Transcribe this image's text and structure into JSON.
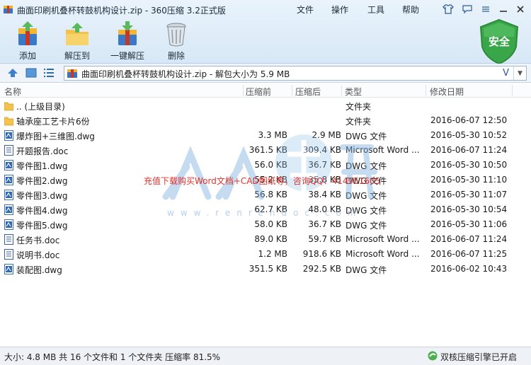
{
  "window": {
    "title": "曲面印刷机叠杯转鼓机构设计.zip - 360压缩 3.2正式版",
    "menu": [
      "文件",
      "操作",
      "工具",
      "帮助"
    ]
  },
  "toolbar": {
    "add_label": "添加",
    "extract_label": "解压到",
    "one_click_label": "一键解压",
    "delete_label": "删除"
  },
  "security_badge": {
    "label": "安全",
    "color": "#3aa64a"
  },
  "address": {
    "path_text": "曲面印刷机叠杯转鼓机构设计.zip - 解包大小为 5.9 MB",
    "v_mark": "V"
  },
  "columns": {
    "name": "名称",
    "size": "压缩前",
    "packed": "压缩后",
    "type": "类型",
    "modified": "修改日期"
  },
  "files": [
    {
      "name": ".. (上级目录)",
      "size": "",
      "packed": "",
      "type": "文件夹",
      "modified": "",
      "icon": "folder-icon"
    },
    {
      "name": "轴承座工艺卡片6份",
      "size": "",
      "packed": "",
      "type": "文件夹",
      "modified": "2016-06-07 12:50",
      "icon": "folder-icon"
    },
    {
      "name": "爆炸图+三维图.dwg",
      "size": "3.3 MB",
      "packed": "2.9 MB",
      "type": "DWG 文件",
      "modified": "2016-05-30 10:52",
      "icon": "dwg-file-icon"
    },
    {
      "name": "开题报告.doc",
      "size": "361.5 KB",
      "packed": "309.4 KB",
      "type": "Microsoft Word ...",
      "modified": "2016-06-07 11:24",
      "icon": "doc-file-icon"
    },
    {
      "name": "零件图1.dwg",
      "size": "56.0 KB",
      "packed": "36.7 KB",
      "type": "DWG 文件",
      "modified": "2016-05-30 10:50",
      "icon": "dwg-file-icon"
    },
    {
      "name": "零件图2.dwg",
      "size": "55.2 KB",
      "packed": "35.8 KB",
      "type": "DWG 文件",
      "modified": "2016-05-30 11:10",
      "icon": "dwg-file-icon"
    },
    {
      "name": "零件图3.dwg",
      "size": "56.8 KB",
      "packed": "38.4 KB",
      "type": "DWG 文件",
      "modified": "2016-05-30 11:07",
      "icon": "dwg-file-icon"
    },
    {
      "name": "零件图4.dwg",
      "size": "62.7 KB",
      "packed": "48.0 KB",
      "type": "DWG 文件",
      "modified": "2016-05-30 10:54",
      "icon": "dwg-file-icon"
    },
    {
      "name": "零件图5.dwg",
      "size": "58.0 KB",
      "packed": "36.7 KB",
      "type": "DWG 文件",
      "modified": "2016-05-30 11:06",
      "icon": "dwg-file-icon"
    },
    {
      "name": "任务书.doc",
      "size": "89.0 KB",
      "packed": "59.7 KB",
      "type": "Microsoft Word ...",
      "modified": "2016-06-07 11:24",
      "icon": "doc-file-icon"
    },
    {
      "name": "说明书.doc",
      "size": "1.2 MB",
      "packed": "918.6 KB",
      "type": "Microsoft Word ...",
      "modified": "2016-06-07 11:25",
      "icon": "doc-file-icon"
    },
    {
      "name": "装配图.dwg",
      "size": "351.5 KB",
      "packed": "292.5 KB",
      "type": "DWG 文件",
      "modified": "2016-06-02 10:43",
      "icon": "dwg-file-icon"
    }
  ],
  "watermark": {
    "notice": "充值下载购买Word文档+CAD图纸等，咨询QQ：414951605",
    "url": "www.renrendoc.com"
  },
  "status": {
    "summary": "大小: 4.8 MB 共 16 个文件和 1 个文件夹 压缩率 81.5%",
    "engine": "双核压缩引擎已开启"
  }
}
